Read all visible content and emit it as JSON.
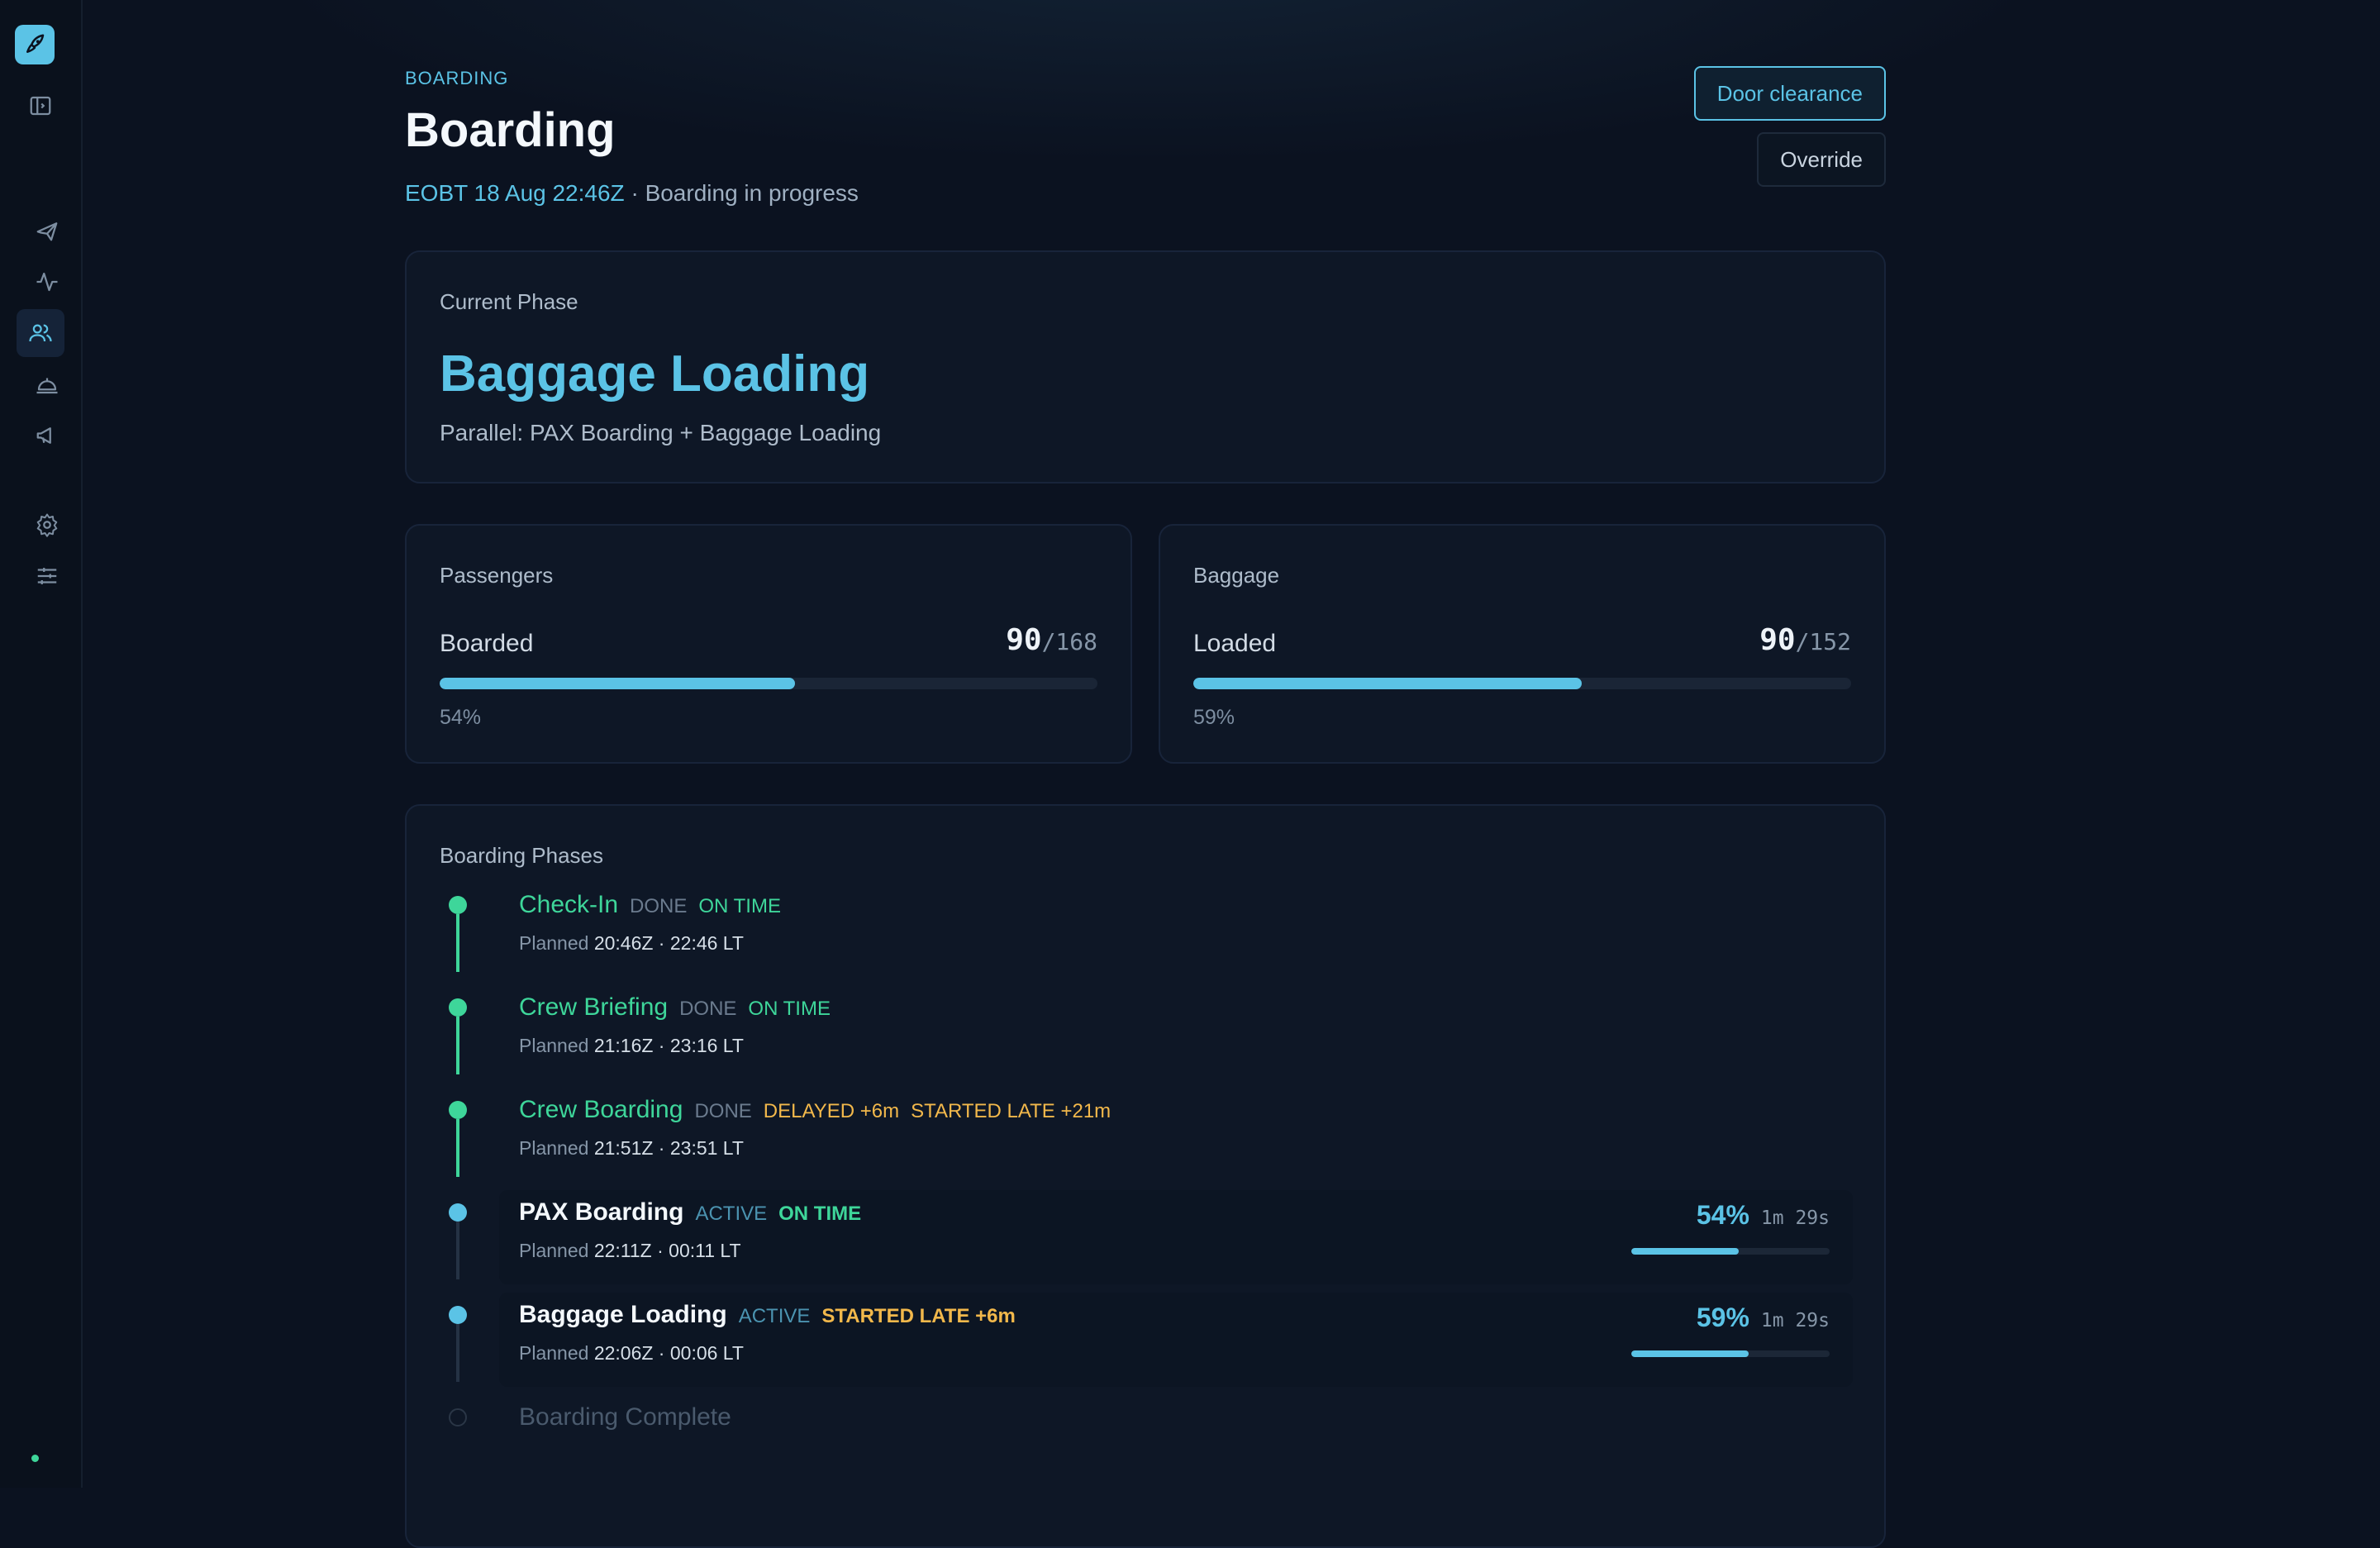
{
  "header": {
    "eyebrow": "BOARDING",
    "title": "Boarding",
    "eobt": "EOBT 18 Aug 22:46Z",
    "status_sep": " · ",
    "status": "Boarding in progress",
    "door_button": "Door clearance",
    "override_button": "Override"
  },
  "current_phase": {
    "label": "Current Phase",
    "name": "Baggage Loading",
    "parallel": "Parallel: PAX Boarding + Baggage Loading"
  },
  "passengers": {
    "label": "Passengers",
    "row_label": "Boarded",
    "value": "90",
    "total": "/168",
    "percent_text": "54%",
    "progress": 0.54
  },
  "baggage": {
    "label": "Baggage",
    "row_label": "Loaded",
    "value": "90",
    "total": "/152",
    "percent_text": "59%",
    "progress": 0.59
  },
  "phases": {
    "label": "Boarding Phases",
    "items": [
      {
        "name": "Check-In",
        "state": "DONE",
        "tags": [
          {
            "text": "ON TIME",
            "color": "#3ed69a"
          }
        ],
        "planned_label": "Planned",
        "planned": "20:46Z · 22:46 LT"
      },
      {
        "name": "Crew Briefing",
        "state": "DONE",
        "tags": [
          {
            "text": "ON TIME",
            "color": "#3ed69a"
          }
        ],
        "planned_label": "Planned",
        "planned": "21:16Z · 23:16 LT"
      },
      {
        "name": "Crew Boarding",
        "state": "DONE",
        "tags": [
          {
            "text": "DELAYED +6m",
            "color": "#f2b84b"
          },
          {
            "text": "STARTED LATE +21m",
            "color": "#f2b84b"
          }
        ],
        "planned_label": "Planned",
        "planned": "21:51Z · 23:51 LT"
      },
      {
        "name": "PAX Boarding",
        "state": "ACTIVE",
        "tags": [
          {
            "text": "ON TIME",
            "color": "#3ed69a"
          }
        ],
        "planned_label": "Planned",
        "planned": "22:11Z · 00:11 LT",
        "percent": "54%",
        "elapsed": "1m 29s",
        "progress": 0.54
      },
      {
        "name": "Baggage Loading",
        "state": "ACTIVE",
        "tags": [
          {
            "text": "STARTED LATE +6m",
            "color": "#f2b84b"
          }
        ],
        "planned_label": "Planned",
        "planned": "22:06Z · 00:06 LT",
        "percent": "59%",
        "elapsed": "1m 29s",
        "progress": 0.59
      },
      {
        "name": "Boarding Complete",
        "state": "PENDING",
        "tags": []
      }
    ]
  },
  "colors": {
    "accent": "#5bc3e6",
    "done": "#3ed69a",
    "warn": "#f2b84b"
  }
}
